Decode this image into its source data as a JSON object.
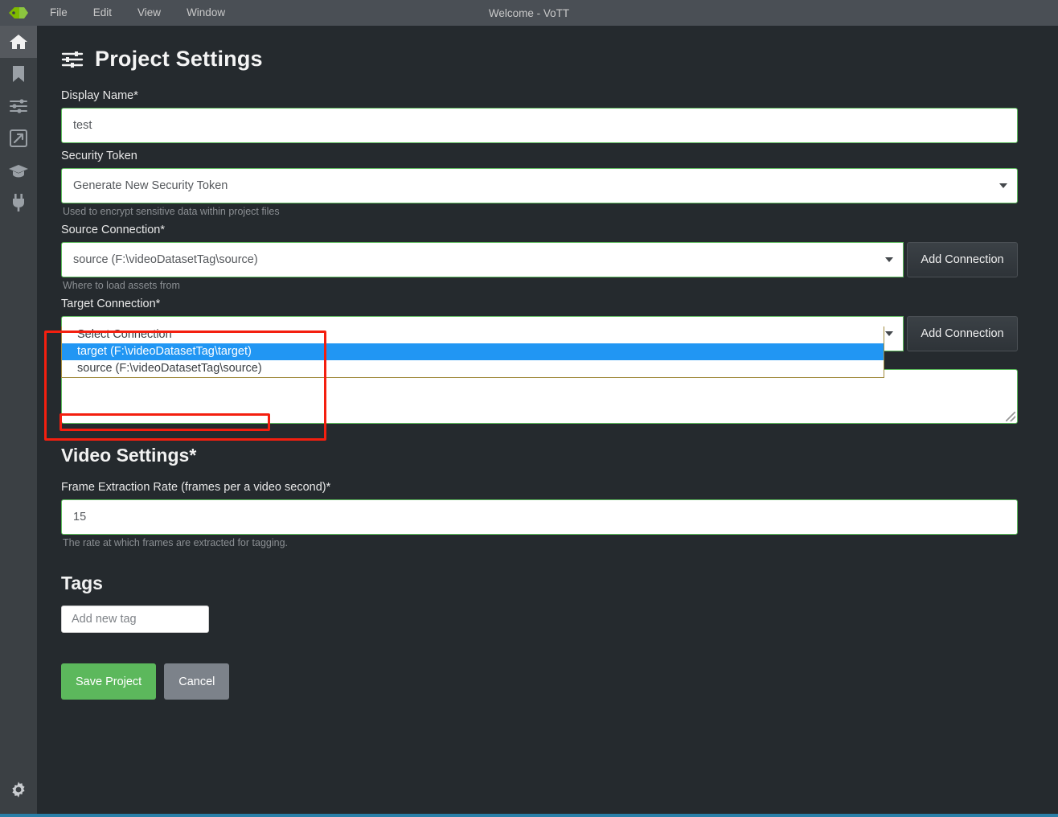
{
  "titlebar": {
    "logo_icon": "tag-logo-icon",
    "window_title": "Welcome - VoTT",
    "menus": [
      {
        "label": "File"
      },
      {
        "label": "Edit"
      },
      {
        "label": "View"
      },
      {
        "label": "Window"
      }
    ]
  },
  "sidebar": {
    "items": [
      {
        "name": "home",
        "icon": "home-icon",
        "active": true
      },
      {
        "name": "bookmark",
        "icon": "bookmark-icon",
        "active": false
      },
      {
        "name": "settings-sliders",
        "icon": "sliders-icon",
        "active": false
      },
      {
        "name": "export",
        "icon": "export-arrow-icon",
        "active": false
      },
      {
        "name": "training",
        "icon": "graduation-cap-icon",
        "active": false
      },
      {
        "name": "connections",
        "icon": "plug-icon",
        "active": false
      }
    ],
    "footer": {
      "name": "app-settings",
      "icon": "gear-icon"
    }
  },
  "page": {
    "title": "Project Settings",
    "title_icon": "sliders-icon"
  },
  "form": {
    "display_name": {
      "label": "Display Name*",
      "value": "test"
    },
    "security_token": {
      "label": "Security Token",
      "value": "Generate New Security Token",
      "hint": "Used to encrypt sensitive data within project files",
      "caret_icon": "chevron-down-icon"
    },
    "source_connection": {
      "label": "Source Connection*",
      "value": "source (F:\\videoDatasetTag\\source)",
      "hint": "Where to load assets from",
      "button_label": "Add Connection",
      "caret_icon": "chevron-down-icon"
    },
    "target_connection": {
      "label": "Target Connection*",
      "value": "target (F:\\videoDatasetTag\\target)",
      "button_label": "Add Connection",
      "caret_icon": "chevron-down-icon",
      "dropdown_open": true,
      "options": [
        {
          "label": "Select Connection",
          "selected": false
        },
        {
          "label": "target (F:\\videoDatasetTag\\target)",
          "selected": true
        },
        {
          "label": "source (F:\\videoDatasetTag\\source)",
          "selected": false
        }
      ]
    },
    "description": {
      "value": ""
    },
    "video_settings": {
      "heading": "Video Settings*",
      "frame_rate": {
        "label": "Frame Extraction Rate (frames per a video second)*",
        "value": "15",
        "hint": "The rate at which frames are extracted for tagging."
      }
    },
    "tags": {
      "heading": "Tags",
      "input_placeholder": "Add new tag",
      "input_value": ""
    },
    "actions": {
      "save_label": "Save Project",
      "cancel_label": "Cancel"
    }
  },
  "annotations": [
    {
      "name": "target-connection-highlight"
    },
    {
      "name": "selected-option-highlight"
    }
  ],
  "colors": {
    "accent_green": "#5cb85c",
    "annotation_red": "#f41f0f",
    "option_selected_blue": "#2196f3",
    "panel_bg": "#252a2e",
    "sidebar_bg": "#3b4044",
    "titlebar_bg": "#4a4f55",
    "status_blue": "#2a7fa8"
  }
}
